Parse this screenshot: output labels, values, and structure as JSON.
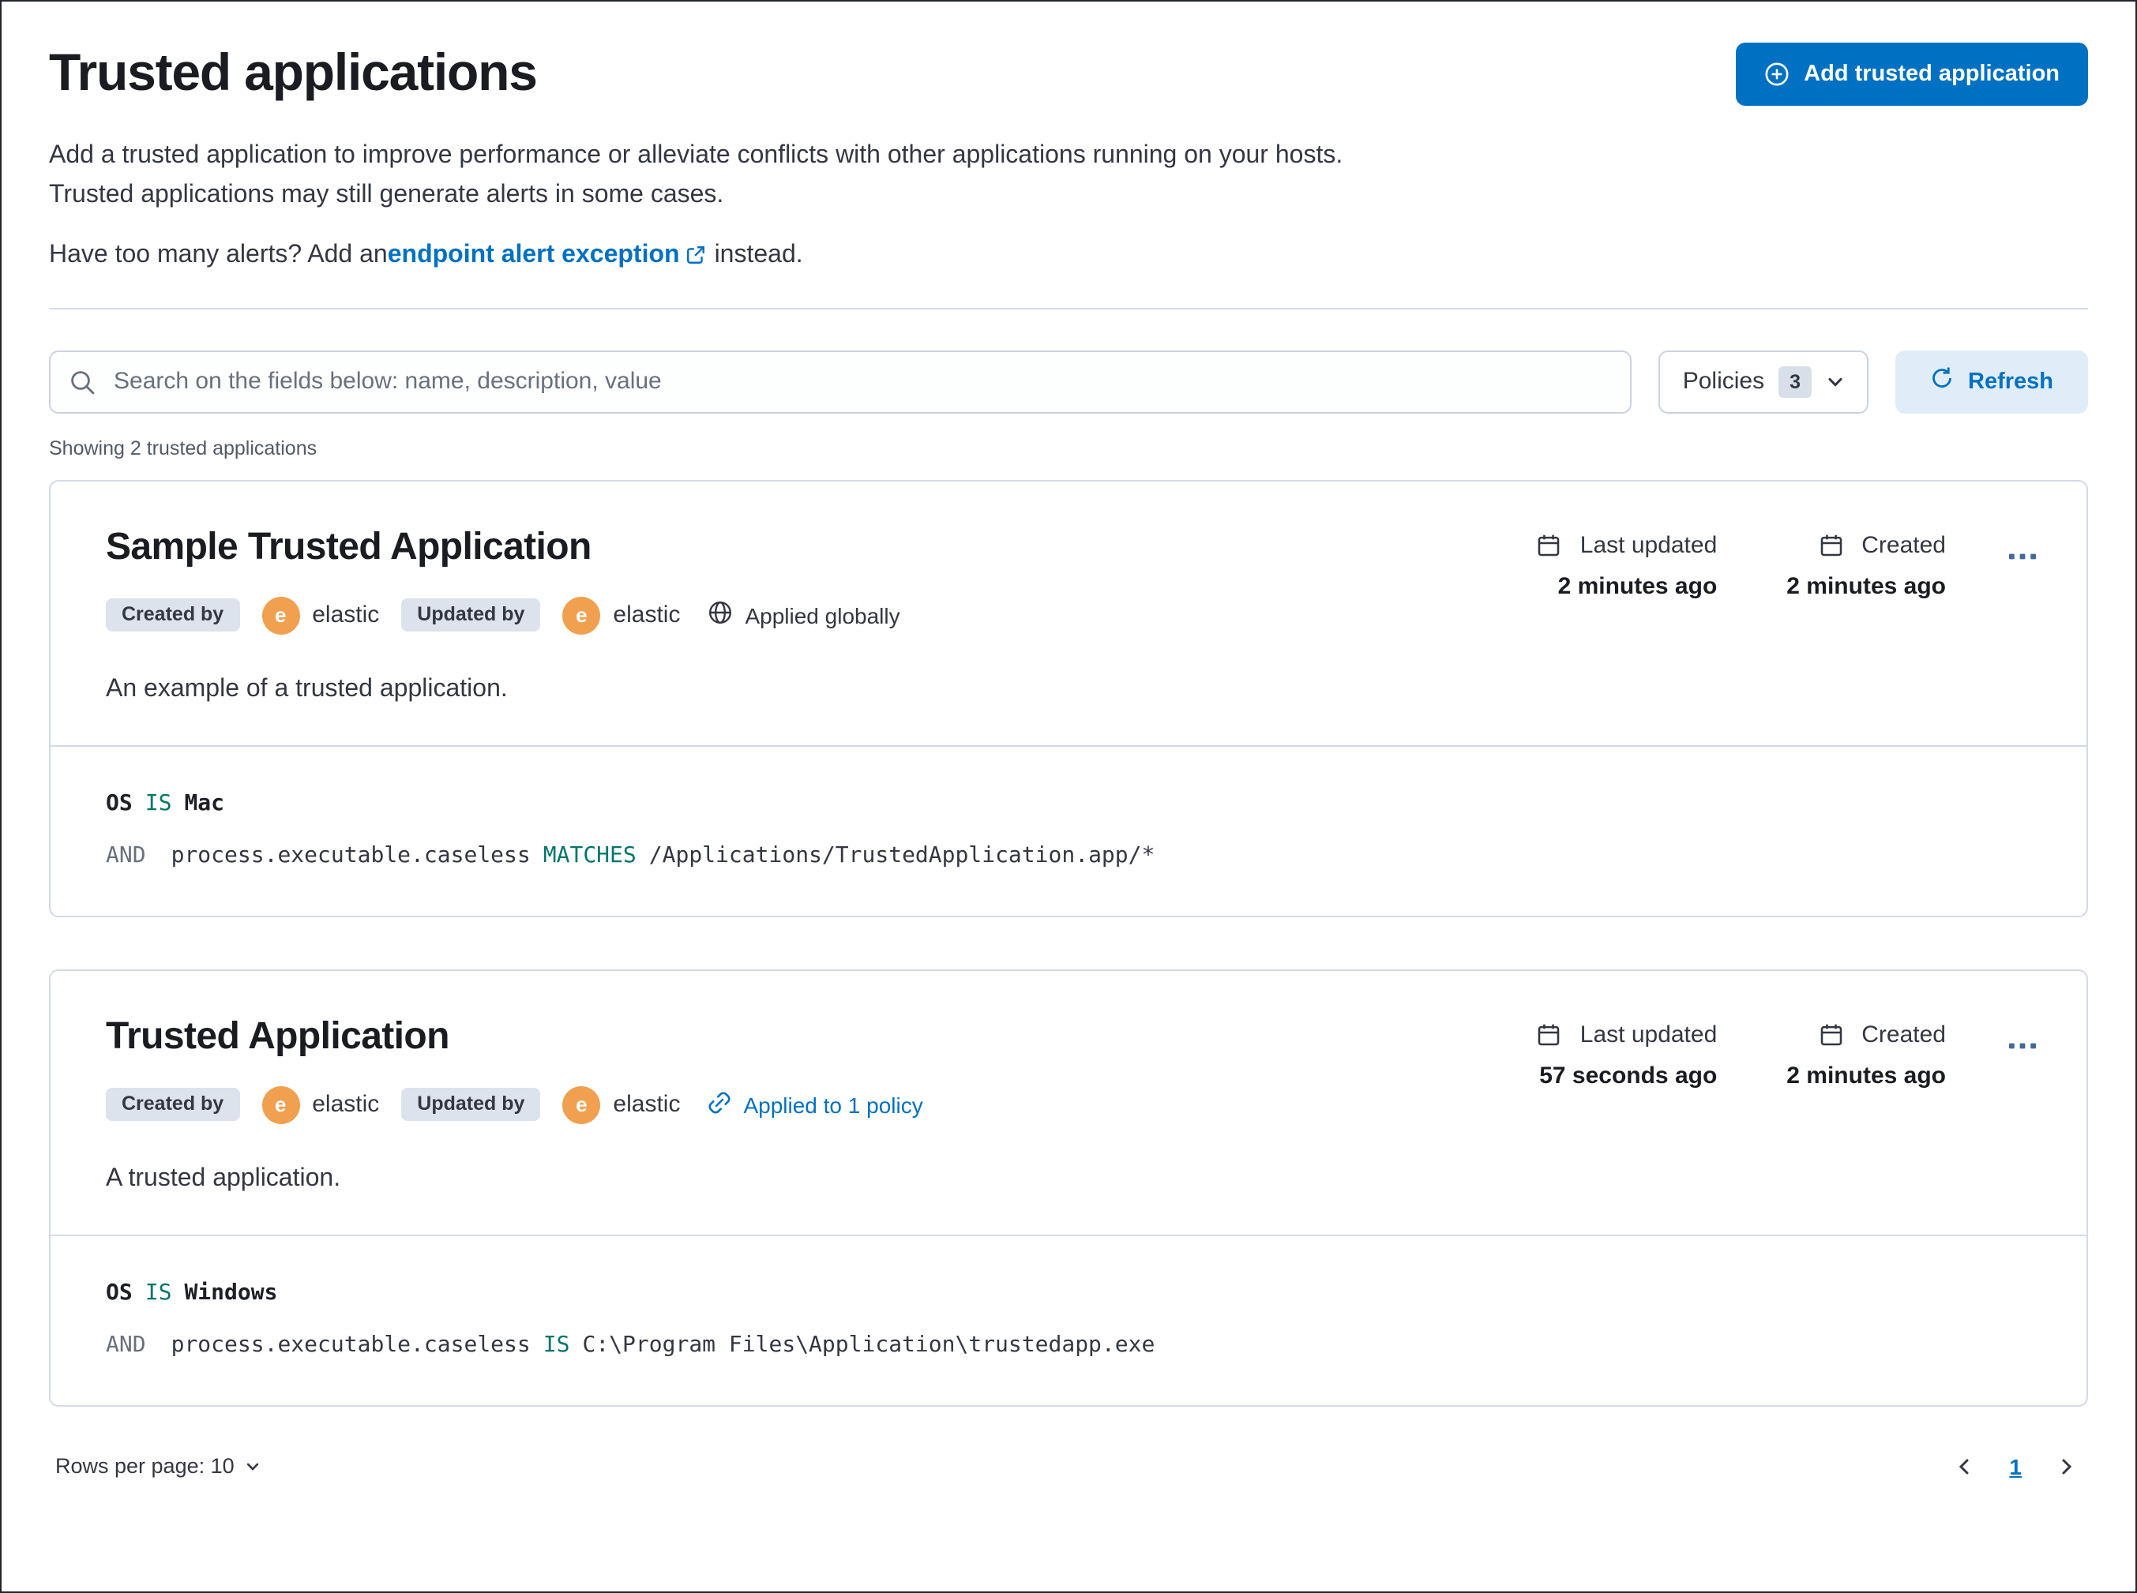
{
  "page": {
    "title": "Trusted applications",
    "description": "Add a trusted application to improve performance or alleviate conflicts with other applications running on your hosts. Trusted applications may still generate alerts in some cases.",
    "alerts_prefix": "Have too many alerts? Add an ",
    "alerts_link_text": "endpoint alert exception",
    "alerts_suffix": " instead.",
    "add_button_label": "Add trusted application",
    "showing_text": "Showing 2 trusted applications"
  },
  "toolbar": {
    "search_placeholder": "Search on the fields below: name, description, value",
    "policies_label": "Policies",
    "policies_count": "3",
    "refresh_label": "Refresh"
  },
  "cards": [
    {
      "title": "Sample Trusted Application",
      "created_by_label": "Created by",
      "created_by_avatar": "e",
      "created_by_user": "elastic",
      "updated_by_label": "Updated by",
      "updated_by_avatar": "e",
      "updated_by_user": "elastic",
      "scope_label": "Applied globally",
      "last_updated_label": "Last updated",
      "last_updated_value": "2 minutes ago",
      "created_label": "Created",
      "created_value": "2 minutes ago",
      "description": "An example of a trusted application.",
      "condition": {
        "os_field": "OS",
        "os_operator": "IS",
        "os_value": "Mac",
        "connector": "AND",
        "field": "process.executable.caseless",
        "operator": "MATCHES",
        "value": "/Applications/TrustedApplication.app/*"
      }
    },
    {
      "title": "Trusted Application",
      "created_by_label": "Created by",
      "created_by_avatar": "e",
      "created_by_user": "elastic",
      "updated_by_label": "Updated by",
      "updated_by_avatar": "e",
      "updated_by_user": "elastic",
      "scope_label": "Applied to 1 policy",
      "last_updated_label": "Last updated",
      "last_updated_value": "57 seconds ago",
      "created_label": "Created",
      "created_value": "2 minutes ago",
      "description": "A trusted application.",
      "condition": {
        "os_field": "OS",
        "os_operator": "IS",
        "os_value": "Windows",
        "connector": "AND",
        "field": "process.executable.caseless",
        "operator": "IS",
        "value": "C:\\Program Files\\Application\\trustedapp.exe"
      }
    }
  ],
  "footer": {
    "rows_per_page_label": "Rows per page: 10",
    "page_number": "1"
  },
  "colors": {
    "primary": "#0071c2",
    "keyword_teal": "#00756b",
    "avatar_orange": "#f0a04e",
    "border_gray": "#d3dae6"
  }
}
